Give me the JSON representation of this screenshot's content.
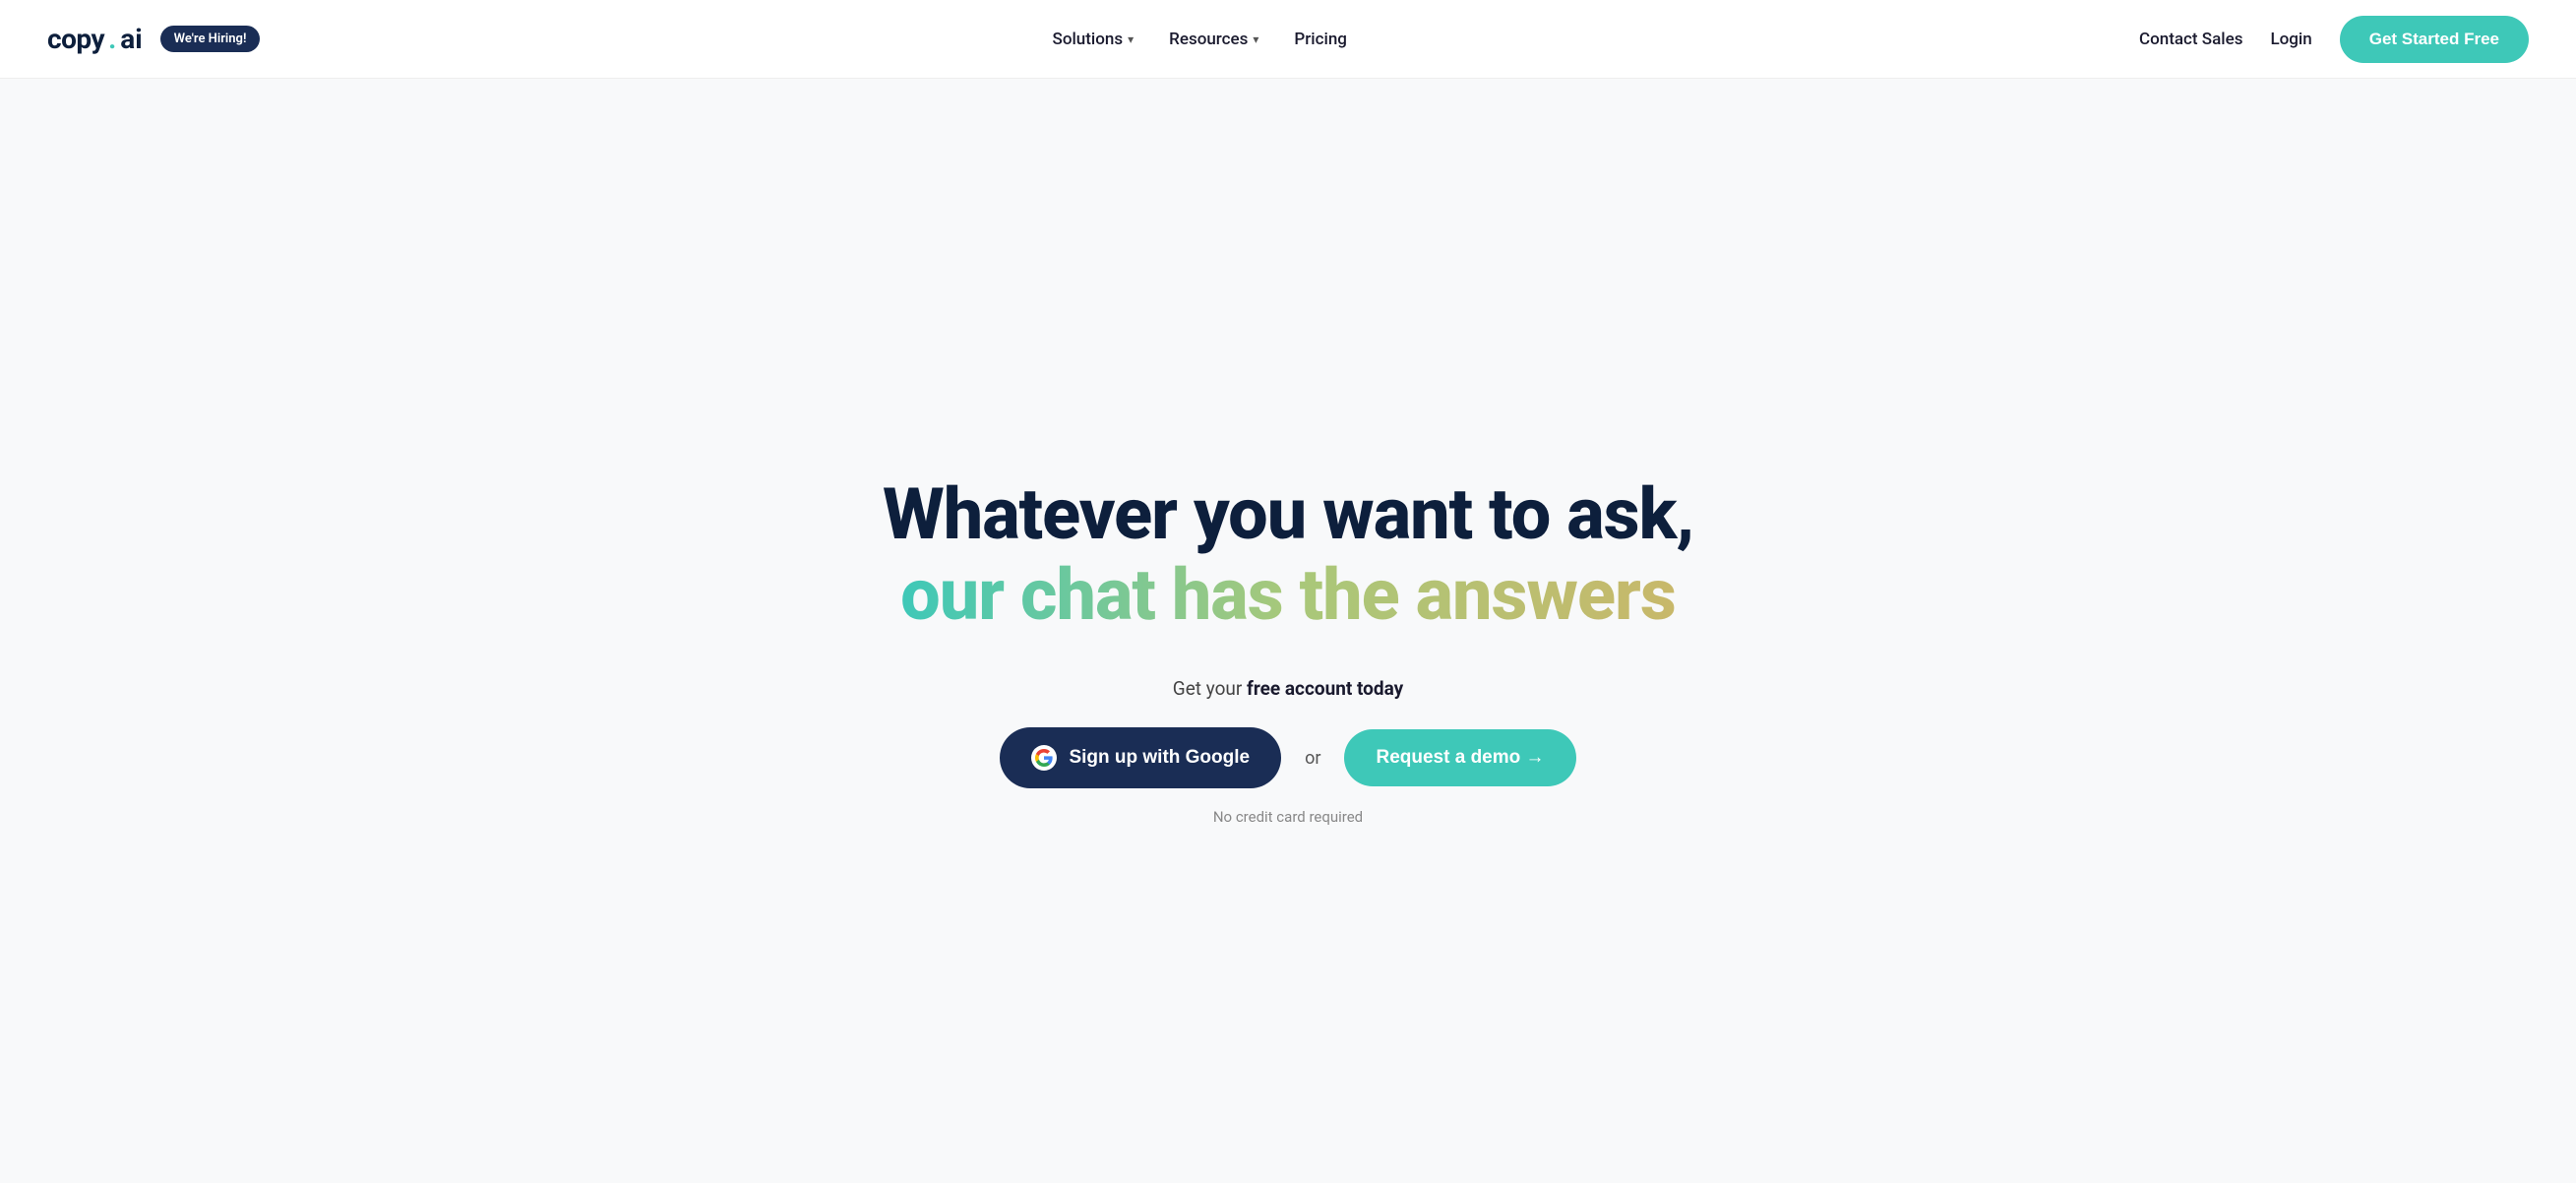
{
  "logo": {
    "copy": "copy",
    "dot": ".",
    "ai": "ai"
  },
  "nav": {
    "hiring_badge": "We're Hiring!",
    "links": [
      {
        "label": "Solutions",
        "has_dropdown": true
      },
      {
        "label": "Resources",
        "has_dropdown": true
      },
      {
        "label": "Pricing",
        "has_dropdown": false
      }
    ],
    "contact_sales": "Contact Sales",
    "login": "Login",
    "get_started": "Get Started Free"
  },
  "hero": {
    "headline_line1": "Whatever you want to ask,",
    "headline_line2": "our chat has the answers",
    "cta_text_prefix": "Get your ",
    "cta_text_bold": "free account today",
    "google_button": "Sign up with Google",
    "or_text": "or",
    "demo_button": "Request a demo →",
    "no_cc_text": "No credit card required"
  }
}
